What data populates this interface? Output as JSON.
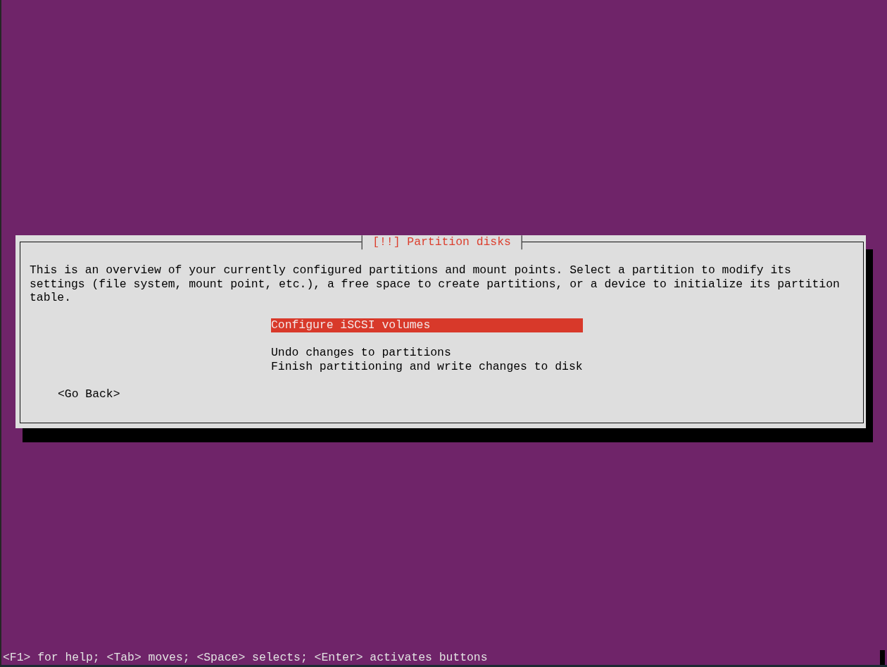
{
  "dialog": {
    "title": "[!!] Partition disks",
    "description": "This is an overview of your currently configured partitions and mount points. Select a partition to modify its settings (file system, mount point, etc.), a free space to create partitions, or a device to initialize its partition table.",
    "menu_groups": [
      {
        "items": [
          {
            "label": "Configure iSCSI volumes",
            "selected": true
          }
        ]
      },
      {
        "items": [
          {
            "label": "Undo changes to partitions",
            "selected": false
          },
          {
            "label": "Finish partitioning and write changes to disk",
            "selected": false
          }
        ]
      }
    ],
    "buttons": [
      {
        "label": "<Go Back>"
      }
    ]
  },
  "status_bar": {
    "text": "<F1> for help; <Tab> moves; <Space> selects; <Enter> activates buttons"
  }
}
